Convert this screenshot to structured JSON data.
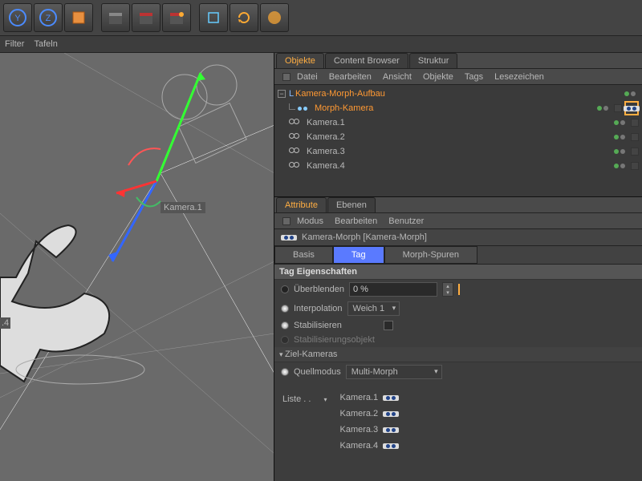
{
  "toolbar": {
    "filter": "Filter",
    "panels": "Tafeln"
  },
  "panels": {
    "objects": "Objekte",
    "content_browser": "Content Browser",
    "structure": "Struktur"
  },
  "menus": {
    "file": "Datei",
    "edit": "Bearbeiten",
    "view": "Ansicht",
    "objects": "Objekte",
    "tags": "Tags",
    "bookmarks": "Lesezeichen"
  },
  "tree": {
    "root": "Kamera-Morph-Aufbau",
    "morph_cam": "Morph-Kamera",
    "cam1": "Kamera.1",
    "cam2": "Kamera.2",
    "cam3": "Kamera.3",
    "cam4": "Kamera.4"
  },
  "attr": {
    "tab_attribute": "Attribute",
    "tab_layers": "Ebenen",
    "menu_mode": "Modus",
    "menu_edit": "Bearbeiten",
    "menu_user": "Benutzer",
    "title": "Kamera-Morph [Kamera-Morph]",
    "btn_basis": "Basis",
    "btn_tag": "Tag",
    "btn_morph": "Morph-Spuren",
    "section_props": "Tag Eigenschaften",
    "blend_label": "Überblenden",
    "blend_value": "0 %",
    "interp_label": "Interpolation",
    "interp_value": "Weich 1",
    "stabilize": "Stabilisieren",
    "stab_obj": "Stabilisierungsobjekt",
    "section_target": "Ziel-Kameras",
    "source_mode": "Quellmodus",
    "source_value": "Multi-Morph",
    "list_label": "Liste . .",
    "list": [
      "Kamera.1",
      "Kamera.2",
      "Kamera.3",
      "Kamera.4"
    ]
  },
  "viewport": {
    "label1": "Kamera.1",
    "label4": ".4"
  }
}
